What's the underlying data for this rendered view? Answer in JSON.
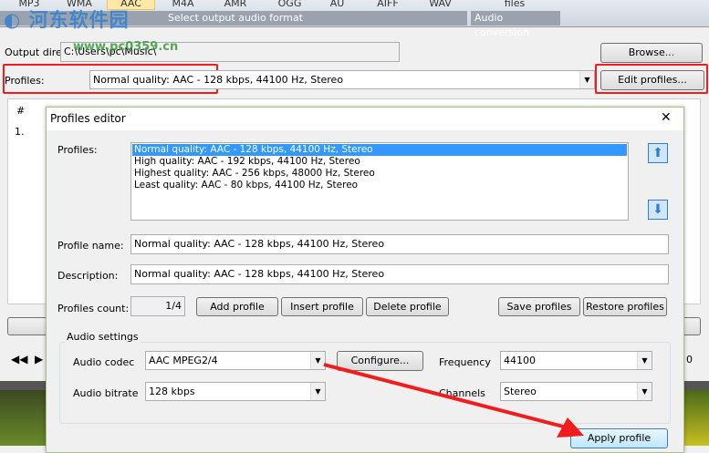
{
  "formats": [
    "MP3",
    "WMA",
    "AAC",
    "M4A",
    "AMR",
    "OGG",
    "AU",
    "AIFF",
    "WAV"
  ],
  "selected_format": "AAC",
  "format_group_label": "Select output audio format",
  "files_label": "files",
  "audio_conversion_label": "Audio conversion",
  "watermark": {
    "title": "河东软件园",
    "url": "www.pc0359.cn"
  },
  "main": {
    "output_dir_label": "Output directory:",
    "output_dir_value": "C:\\Users\\pc\\Music\\",
    "browse": "Browse...",
    "profiles_label": "Profiles:",
    "profile_value": "Normal quality: AAC - 128 kbps, 44100 Hz, Stereo",
    "edit_profiles": "Edit profiles...",
    "col_num": "#",
    "row1": "1.",
    "partial_right": "0"
  },
  "dialog": {
    "title": "Profiles editor",
    "profiles_label": "Profiles:",
    "profiles": [
      "Normal quality: AAC - 128 kbps, 44100 Hz, Stereo",
      "High quality: AAC - 192 kbps, 44100 Hz, Stereo",
      "Highest quality: AAC - 256 kbps, 48000 Hz, Stereo",
      "Least quality: AAC - 80 kbps, 44100 Hz, Stereo"
    ],
    "profile_name_label": "Profile name:",
    "profile_name": "Normal quality: AAC - 128 kbps, 44100 Hz, Stereo",
    "description_label": "Description:",
    "description": "Normal quality: AAC - 128 kbps, 44100 Hz, Stereo",
    "count_label": "Profiles count:",
    "count": "1/4",
    "add": "Add profile",
    "insert": "Insert profile",
    "delete": "Delete profile",
    "save": "Save profiles",
    "restore": "Restore profiles",
    "audio_settings": "Audio settings",
    "codec_label": "Audio codec",
    "codec": "AAC MPEG2/4",
    "configure": "Configure...",
    "frequency_label": "Frequency",
    "frequency": "44100",
    "bitrate_label": "Audio bitrate",
    "bitrate": "128 kbps",
    "channels_label": "Channels",
    "channels": "Stereo",
    "apply": "Apply profile"
  },
  "colors": {
    "highlight": "#f21c1c",
    "selection": "#3399ff",
    "arrow_buttons": "#2f7fd0"
  }
}
